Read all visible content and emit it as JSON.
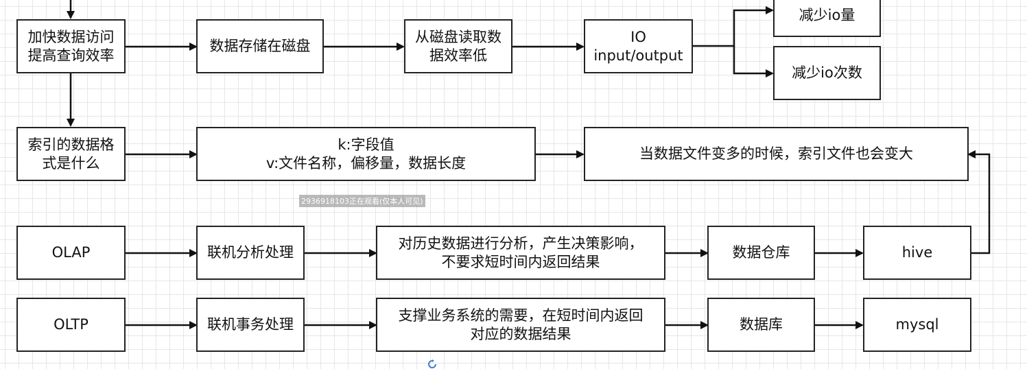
{
  "nodes": {
    "speed_up": "加快数据访问\n提高查询效率",
    "stored_disk": "数据存储在磁盘",
    "read_slow": "从磁盘读取数\n据效率低",
    "io": "IO\ninput/output",
    "reduce_io_amount": "减少io量",
    "reduce_io_count": "减少io次数",
    "index_format": "索引的数据格\n式是什么",
    "kv": "k:字段值\nv:文件名称，偏移量，数据长度",
    "index_grow": "当数据文件变多的时候，索引文件也会变大",
    "olap": "OLAP",
    "olap_desc": "联机分析处理",
    "olap_detail": "对历史数据进行分析，产生决策影响，\n不要求短时间内返回结果",
    "warehouse": "数据仓库",
    "hive": "hive",
    "oltp": "OLTP",
    "oltp_desc": "联机事务处理",
    "oltp_detail": "支撑业务系统的需要，在短时间内返回\n对应的数据结果",
    "database": "数据库",
    "mysql": "mysql"
  },
  "overlay": {
    "watermark": "2936918103正在观看(仅本人可见)"
  },
  "colors": {
    "stroke": "#111111",
    "grid": "#e6e6e6"
  }
}
